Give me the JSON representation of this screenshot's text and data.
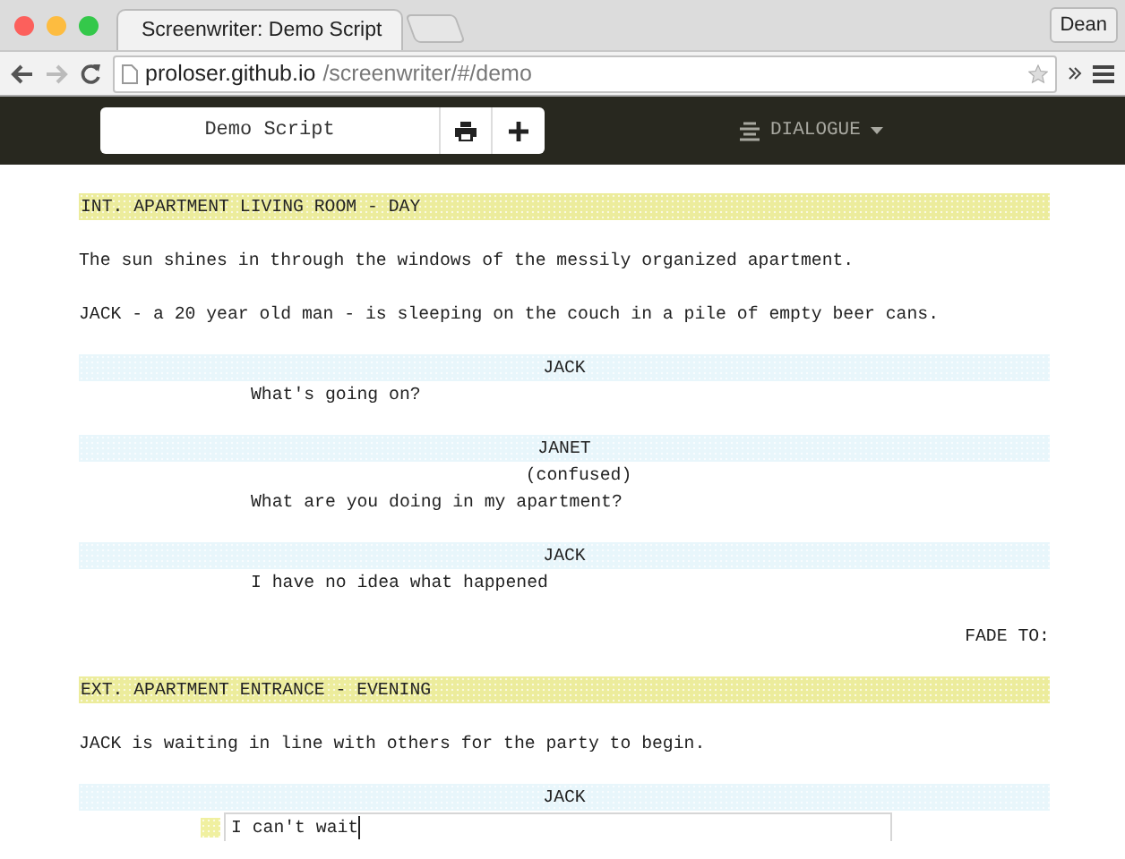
{
  "browser": {
    "tab_title": "Screenwriter: Demo Script",
    "profile": "Dean",
    "url_host": "proloser.github.io",
    "url_path": "/screenwriter/#/demo"
  },
  "toolbar": {
    "title": "Demo Script",
    "element_type": "DIALOGUE"
  },
  "script": [
    {
      "kind": "heading",
      "text": "INT. APARTMENT LIVING ROOM - DAY",
      "active": false
    },
    {
      "kind": "action",
      "text": "The sun shines in through the windows of the messily organized apartment.",
      "active": false
    },
    {
      "kind": "action",
      "text": "JACK - a 20 year old man - is sleeping on the couch in a pile of empty beer cans.",
      "active": false
    },
    {
      "kind": "character",
      "text": "JACK",
      "active": false
    },
    {
      "kind": "dialogue",
      "text": "What's going on?",
      "active": false
    },
    {
      "kind": "character",
      "text": "JANET",
      "active": false
    },
    {
      "kind": "parenthetical",
      "text": "(confused)",
      "active": false
    },
    {
      "kind": "dialogue",
      "text": "What are you doing in my apartment?",
      "active": false
    },
    {
      "kind": "character",
      "text": "JACK",
      "active": false
    },
    {
      "kind": "dialogue",
      "text": "I have no idea what happened",
      "active": false
    },
    {
      "kind": "transition",
      "text": "FADE TO:",
      "active": false
    },
    {
      "kind": "heading",
      "text": "EXT. APARTMENT ENTRANCE - EVENING",
      "active": false
    },
    {
      "kind": "action",
      "text": "JACK is waiting in line with others for the party to begin.",
      "active": false
    },
    {
      "kind": "character",
      "text": "JACK",
      "active": false
    },
    {
      "kind": "dialogue",
      "text": "I can't wait",
      "active": true
    }
  ]
}
